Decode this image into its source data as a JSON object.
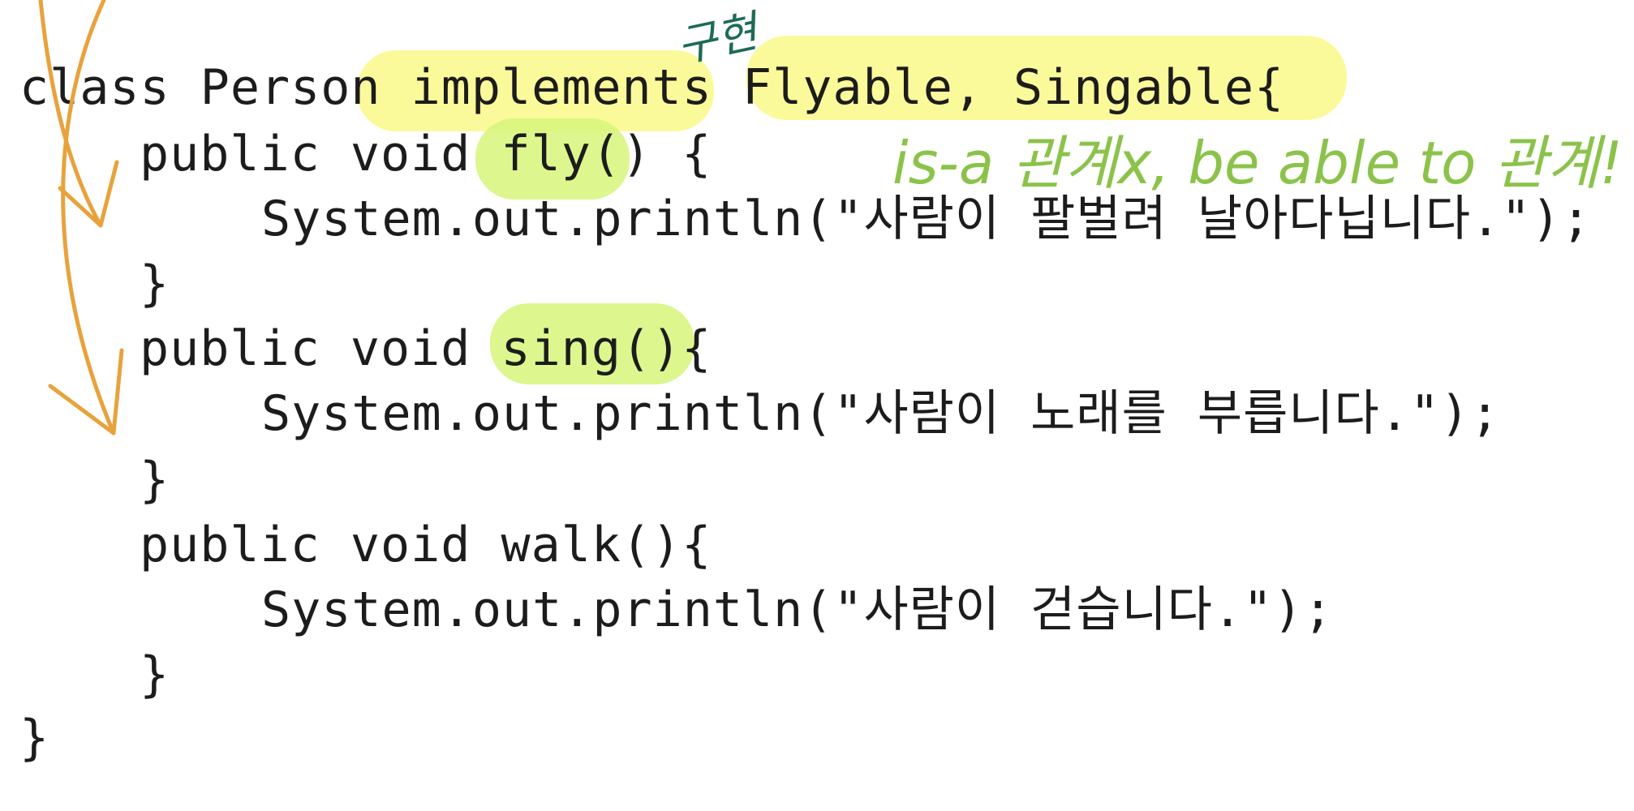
{
  "code": {
    "lines": [
      "class Person implements Flyable, Singable{",
      "public void fly() {",
      "System.out.println(\"사람이 팔벌려 날아다닙니다.\");",
      "}",
      "public void sing(){",
      "System.out.println(\"사람이 노래를 부릅니다.\");",
      "}",
      "public void walk(){",
      "System.out.println(\"사람이 걷습니다.\");",
      "}",
      "}"
    ]
  },
  "annotations": {
    "top_note": "구현",
    "side_note": "is-a 관계x, be able to 관계!"
  },
  "colors": {
    "highlight_yellow": "#faf98a",
    "highlight_green": "#d7f57a",
    "arrow_orange": "#e8a23c",
    "note_green": "#8bc34a",
    "note_dark_green": "#1e6b55"
  }
}
